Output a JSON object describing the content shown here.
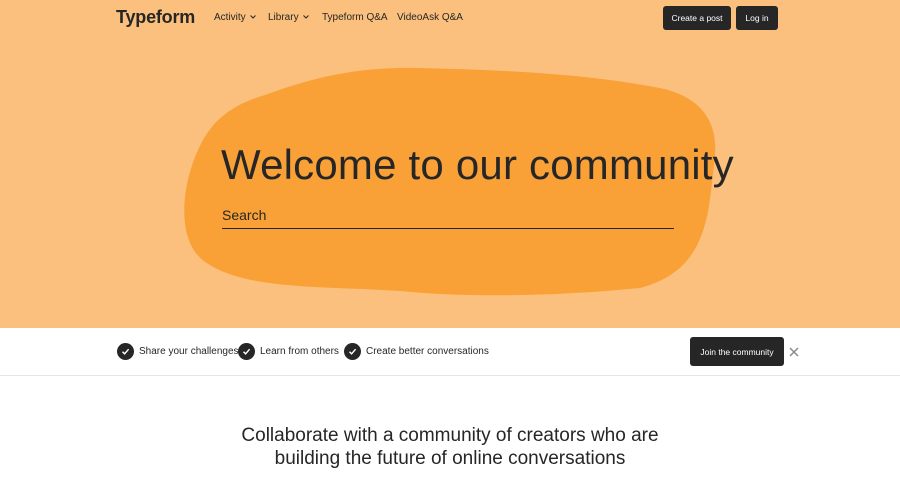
{
  "nav": {
    "logo": "Typeform",
    "links": [
      {
        "label": "Activity"
      },
      {
        "label": "Library"
      },
      {
        "label": "Typeform Q&A"
      },
      {
        "label": "VideoAsk Q&A"
      }
    ],
    "create_post": "Create a post",
    "login": "Log in"
  },
  "hero": {
    "title": "Welcome to our community",
    "search_placeholder": "Search"
  },
  "banner": {
    "features": [
      {
        "label": "Share your challenges"
      },
      {
        "label": "Learn from others"
      },
      {
        "label": "Create better conversations"
      }
    ],
    "join": "Join the community"
  },
  "main": {
    "tagline_line1": "Collaborate with a community of creators who are",
    "tagline_line2": "building the future of online conversations"
  },
  "colors": {
    "hero_bg": "#fbc07d",
    "blob": "#f9a137",
    "dark": "#262627"
  },
  "icons": {
    "dropdown": "chevron-down-icon",
    "feature": "check-circle-icon",
    "dismiss": "close-icon"
  }
}
